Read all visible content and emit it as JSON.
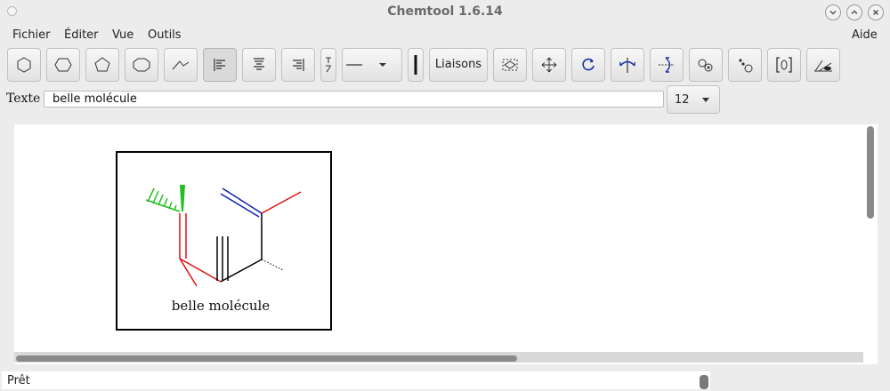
{
  "window": {
    "title": "Chemtool 1.6.14"
  },
  "menu": {
    "items": [
      "Fichier",
      "Éditer",
      "Vue",
      "Outils"
    ],
    "help": "Aide"
  },
  "toolbar": {
    "bonds_label": "Liaisons"
  },
  "text_row": {
    "label": "Texte :",
    "value": "belle molécule",
    "font_size": "12"
  },
  "canvas": {
    "molecule_label": "belle molécule"
  },
  "status": {
    "text": "Prêt"
  },
  "colors": {
    "red_bond": "#e01010",
    "blue_bond": "#1020b0",
    "green_bond": "#20c020",
    "black_bond": "#000000"
  }
}
